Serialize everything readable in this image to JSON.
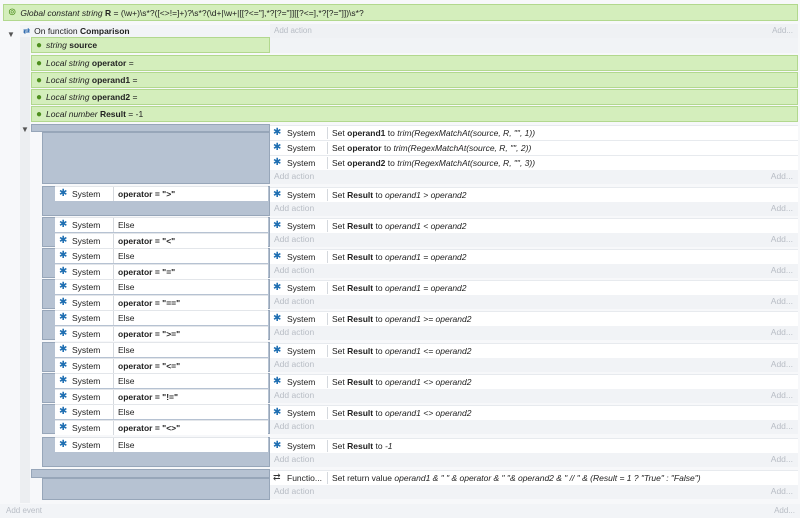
{
  "global": {
    "prefix": "Global constant string",
    "name": "R",
    "value": "= (\\w+)\\s*?([<>!=]+)?\\s*?(\\d+|\\w+|[[?<=\"],*?[?=\"]][[?<=],*?[?=\"]])\\s*?",
    "addact": "Add..."
  },
  "func": {
    "prefix": "On function",
    "name": "Comparison",
    "addaction": "Add action",
    "add": "Add...",
    "param_type": "string",
    "param_name": "source"
  },
  "locals": [
    {
      "type": "Local string",
      "name": "operator",
      "value": "="
    },
    {
      "type": "Local string",
      "name": "operand1",
      "value": "="
    },
    {
      "type": "Local string",
      "name": "operand2",
      "value": "="
    },
    {
      "type": "Local number",
      "name": "Result",
      "value": "= -1"
    }
  ],
  "system": "System",
  "function_obj": "Functio...",
  "add_action": "Add action",
  "add_short": "Add...",
  "add_event": "Add event",
  "set": "Set",
  "to": "to",
  "block1": {
    "actions": [
      {
        "var": "operand1",
        "expr": "trim(RegexMatchAt(source, R, \"\", 1))"
      },
      {
        "var": "operator",
        "expr": "trim(RegexMatchAt(source, R, \"\", 2))"
      },
      {
        "var": "operand2",
        "expr": "trim(RegexMatchAt(source, R, \"\", 3))"
      }
    ]
  },
  "subs": [
    {
      "else": "",
      "cond": "operator = \">\"",
      "expr": "operand1 > operand2"
    },
    {
      "else": "Else",
      "cond": "operator = \"<\"",
      "expr": "operand1 < operand2"
    },
    {
      "else": "Else",
      "cond": "operator = \"=\"",
      "expr": "operand1 = operand2"
    },
    {
      "else": "Else",
      "cond": "operator = \"==\"",
      "expr": "operand1 = operand2"
    },
    {
      "else": "Else",
      "cond": "operator = \">=\"",
      "expr": "operand1 >= operand2"
    },
    {
      "else": "Else",
      "cond": "operator = \"<=\"",
      "expr": "operand1 <= operand2"
    },
    {
      "else": "Else",
      "cond": "operator = \"!=\"",
      "expr": "operand1 <> operand2"
    },
    {
      "else": "Else",
      "cond": "operator = \"<>\"",
      "expr": "operand1 <> operand2"
    },
    {
      "else": "Else",
      "cond": "",
      "expr": "-1"
    }
  ],
  "set_result": "Result",
  "return_action": {
    "prefix": "Set return value",
    "expr": "operand1 & \" \" & operator & \" \"& operand2 & \"    // \" & (Result = 1 ? \"True\" : \"False\")"
  }
}
